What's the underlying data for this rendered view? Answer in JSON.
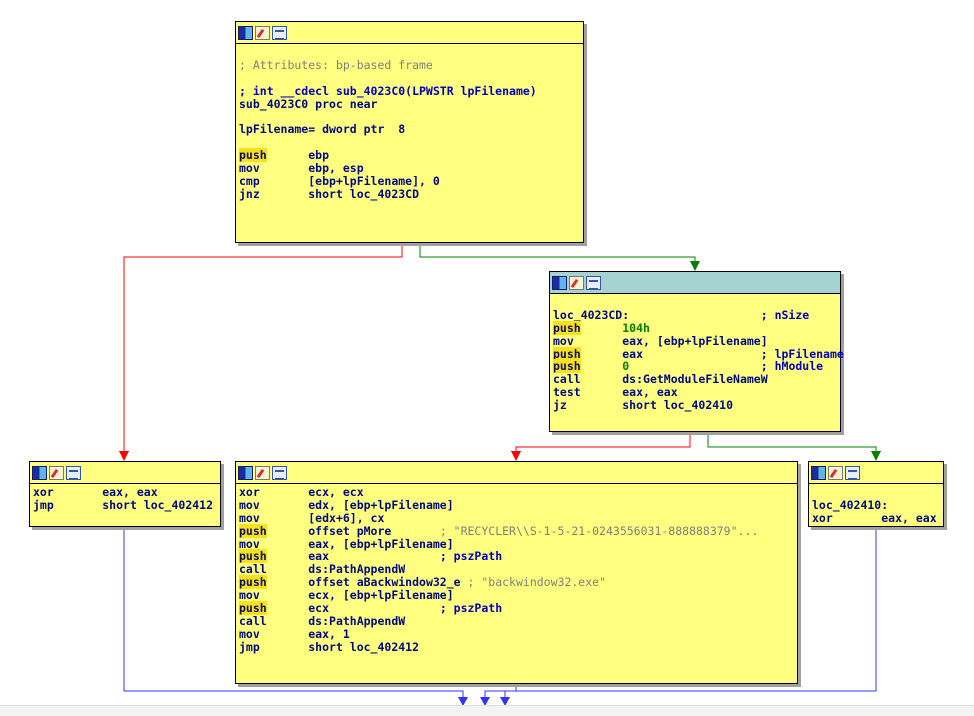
{
  "nodes": {
    "entry": {
      "lines": [
        {
          "text": "",
          "kind": "blank"
        },
        {
          "text": "; Attributes: bp-based frame",
          "kind": "comment"
        },
        {
          "text": "",
          "kind": "blank"
        },
        {
          "text": "; int __cdecl sub_4023C0(LPWSTR lpFilename)",
          "kind": "proto"
        },
        {
          "text": "sub_4023C0 proc near",
          "kind": "label"
        },
        {
          "text": "",
          "kind": "blank"
        },
        {
          "text": "lpFilename= dword ptr  8",
          "kind": "var"
        },
        {
          "text": "",
          "kind": "blank"
        },
        {
          "mnemonic": "push",
          "hl": true,
          "operand": "ebp"
        },
        {
          "mnemonic": "mov",
          "hl": false,
          "operand": "ebp, esp"
        },
        {
          "mnemonic": "cmp",
          "hl": false,
          "operand": "[ebp+lpFilename], 0"
        },
        {
          "mnemonic": "jnz",
          "hl": false,
          "operand": "short loc_4023CD"
        }
      ]
    },
    "loc_4023CD": {
      "lines": [
        {
          "text": "",
          "kind": "blank"
        },
        {
          "label": "loc_4023CD:",
          "comment": "; nSize",
          "kind": "labelcomment"
        },
        {
          "mnemonic": "push",
          "hl": true,
          "operand": "104h"
        },
        {
          "mnemonic": "mov",
          "hl": false,
          "operand": "eax, [ebp+lpFilename]"
        },
        {
          "mnemonic": "push",
          "hl": true,
          "operand": "eax",
          "comment": "; lpFilename"
        },
        {
          "mnemonic": "push",
          "hl": true,
          "operand": "0",
          "comment": "; hModule"
        },
        {
          "mnemonic": "call",
          "hl": false,
          "operand": "ds:GetModuleFileNameW"
        },
        {
          "mnemonic": "test",
          "hl": false,
          "operand": "eax, eax"
        },
        {
          "mnemonic": "jz",
          "hl": false,
          "operand": "short loc_402410"
        }
      ]
    },
    "null_branch": {
      "lines": [
        {
          "mnemonic": "xor",
          "hl": false,
          "operand": "eax, eax"
        },
        {
          "mnemonic": "jmp",
          "hl": false,
          "operand": "short loc_402412"
        }
      ]
    },
    "main_block": {
      "lines": [
        {
          "mnemonic": "xor",
          "hl": false,
          "operand": "ecx, ecx"
        },
        {
          "mnemonic": "mov",
          "hl": false,
          "operand": "edx, [ebp+lpFilename]"
        },
        {
          "mnemonic": "mov",
          "hl": false,
          "operand": "[edx+6], cx"
        },
        {
          "mnemonic": "push",
          "hl": true,
          "operand": "offset pMore",
          "comment": "; \"RECYCLER\\\\S-1-5-21-0243556031-888888379\"..."
        },
        {
          "mnemonic": "mov",
          "hl": false,
          "operand": "eax, [ebp+lpFilename]"
        },
        {
          "mnemonic": "push",
          "hl": true,
          "operand": "eax",
          "comment": "; pszPath"
        },
        {
          "mnemonic": "call",
          "hl": false,
          "operand": "ds:PathAppendW"
        },
        {
          "mnemonic": "push",
          "hl": true,
          "operand": "offset aBackwindow32_e",
          "comment": "; \"backwindow32.exe\""
        },
        {
          "mnemonic": "mov",
          "hl": false,
          "operand": "ecx, [ebp+lpFilename]"
        },
        {
          "mnemonic": "push",
          "hl": true,
          "operand": "ecx",
          "comment": "; pszPath"
        },
        {
          "mnemonic": "call",
          "hl": false,
          "operand": "ds:PathAppendW"
        },
        {
          "mnemonic": "mov",
          "hl": false,
          "operand": "eax, 1"
        },
        {
          "mnemonic": "jmp",
          "hl": false,
          "operand": "short loc_402412"
        }
      ]
    },
    "loc_402410": {
      "lines": [
        {
          "text": "",
          "kind": "blank"
        },
        {
          "text": "loc_402410:",
          "kind": "label"
        },
        {
          "mnemonic": "xor",
          "hl": false,
          "operand": "eax, eax"
        }
      ]
    }
  },
  "edge_colors": {
    "true_branch": "#ff0000",
    "false_branch": "#008000",
    "unconditional": "#3333ff"
  }
}
